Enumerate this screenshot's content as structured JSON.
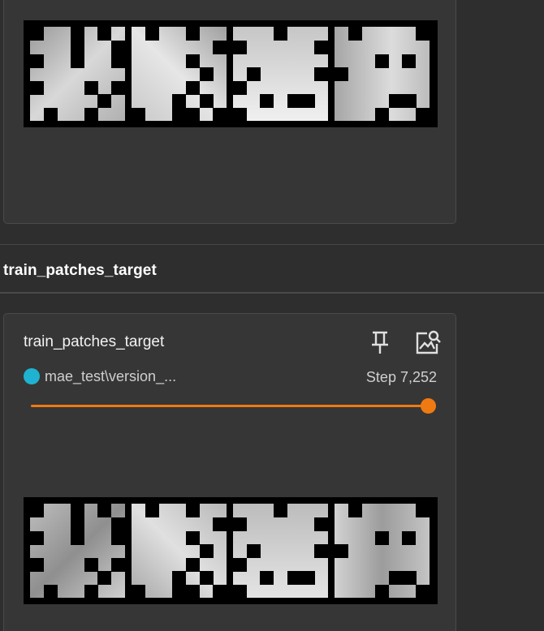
{
  "group": {
    "title": "train_patches_target"
  },
  "card": {
    "title": "train_patches_target",
    "run_name": "mae_test\\version_...",
    "step_label": "Step 7,252",
    "step_value": 7252,
    "slider_fraction": 1.0
  },
  "colors": {
    "run_color": "#1fb3d1",
    "slider_color": "#f07a12",
    "background": "#2e2e2e",
    "card_background": "#363636"
  },
  "icons": {
    "pin": "pin-icon",
    "image_zoom": "image-search-icon"
  }
}
